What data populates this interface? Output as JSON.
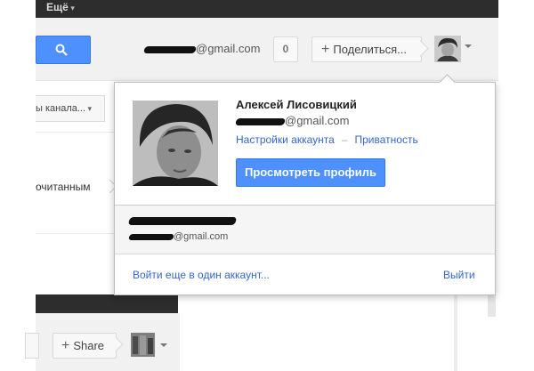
{
  "topbar": {
    "more_label": "Ещё"
  },
  "header": {
    "email_domain": "@gmail.com",
    "notification_count": "0",
    "share_label": "Поделиться..."
  },
  "background": {
    "channels_label": "ы канала...",
    "read_label": "очитанным"
  },
  "popup": {
    "name": "Алексей Лисовицкий",
    "email_domain": "@gmail.com",
    "account_settings": "Настройки аккаунта",
    "separator": "–",
    "privacy": "Приватность",
    "view_profile": "Просмотреть профиль",
    "other_account_email_domain": "@gmail.com",
    "add_account": "Войти еще в один аккаунт...",
    "sign_out": "Выйти"
  },
  "second_window": {
    "share_label": "Share"
  },
  "colors": {
    "accent": "#4d90fe",
    "link": "#3366cc",
    "topbar": "#2d2d2d"
  },
  "icons": [
    "search-icon",
    "plus-icon",
    "caret-down-icon",
    "avatar"
  ]
}
